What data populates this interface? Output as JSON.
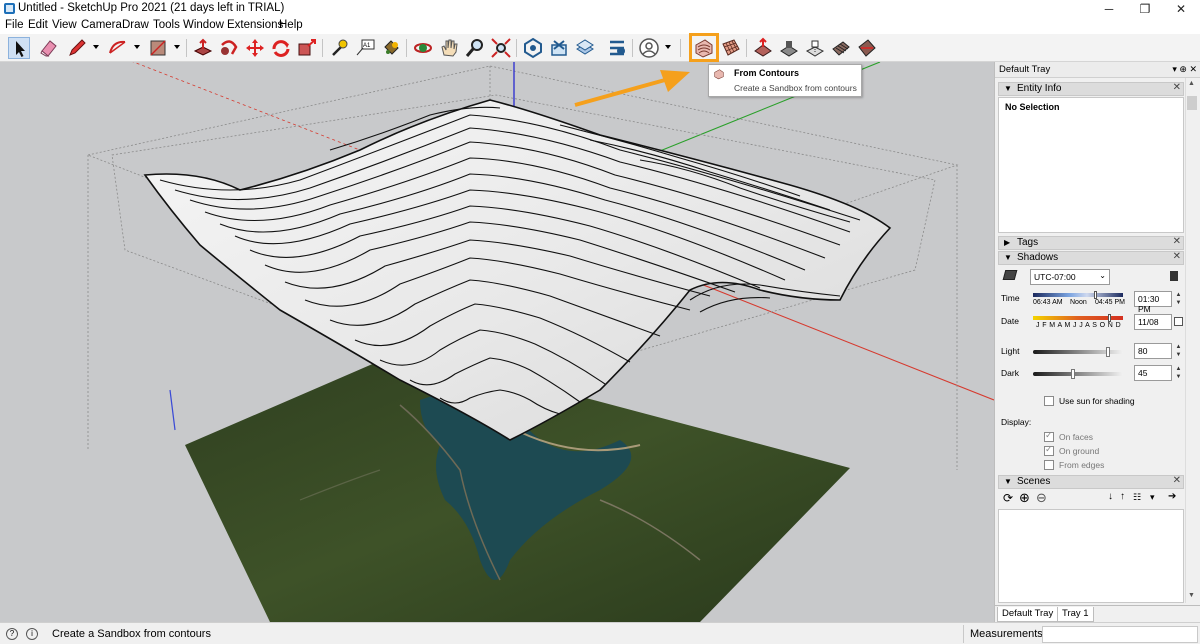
{
  "window": {
    "title": "Untitled - SketchUp Pro 2021 (21 days left in TRIAL)",
    "minimize": "─",
    "restore": "❐",
    "close": "✕"
  },
  "menu": [
    "File",
    "Edit",
    "View",
    "Camera",
    "Draw",
    "Tools",
    "Window",
    "Extensions",
    "Help"
  ],
  "toolbar": {
    "tools": [
      "select-icon",
      "eraser-icon",
      "pencil-icon",
      "arc-icon",
      "rectangle-icon",
      "push-pull-icon",
      "follow-me-icon",
      "move-icon",
      "rotate-icon",
      "scale-icon",
      "tape-measure-icon",
      "text-icon",
      "paint-bucket-icon",
      "orbit-icon",
      "pan-icon",
      "zoom-icon",
      "zoom-extents-icon",
      "warehouse-icon",
      "extension-warehouse-icon",
      "layout-icon",
      "extension-manager-icon",
      "profile-icon",
      "from-contours-icon",
      "from-scratch-icon",
      "smoove-icon",
      "stamp-icon",
      "drape-icon",
      "add-detail-icon",
      "flip-edge-icon"
    ],
    "highlight_color": "#f5a01c"
  },
  "tooltip": {
    "title": "From Contours",
    "description": "Create a Sandbox from contours"
  },
  "tray": {
    "title": "Default Tray",
    "pin": "▾ ⊕ ✕",
    "entity_info": {
      "label": "Entity Info",
      "selection": "No Selection"
    },
    "tags": {
      "label": "Tags"
    },
    "shadows": {
      "label": "Shadows",
      "timezone": "UTC-07:00",
      "time_label": "Time",
      "time_start": "06:43 AM",
      "time_noon": "Noon",
      "time_end": "04:45 PM",
      "time_value": "01:30 PM",
      "date_label": "Date",
      "months": "J F M A M J J A S O N D",
      "date_value": "11/08",
      "light_label": "Light",
      "light_value": "80",
      "dark_label": "Dark",
      "dark_value": "45",
      "use_sun_label": "Use sun for shading",
      "display_label": "Display:",
      "on_faces": "On faces",
      "on_ground": "On ground",
      "from_edges": "From edges"
    },
    "scenes": {
      "label": "Scenes"
    },
    "tabs": [
      "Default Tray",
      "Tray 1"
    ]
  },
  "statusbar": {
    "hint": "Create a Sandbox from contours",
    "measurements_label": "Measurements",
    "measurements_value": ""
  },
  "colors": {
    "viewport_bg": "#c8c9cb",
    "axis_red": "#d63a2f",
    "axis_green": "#2aa02a",
    "axis_blue": "#2a2ad0"
  }
}
